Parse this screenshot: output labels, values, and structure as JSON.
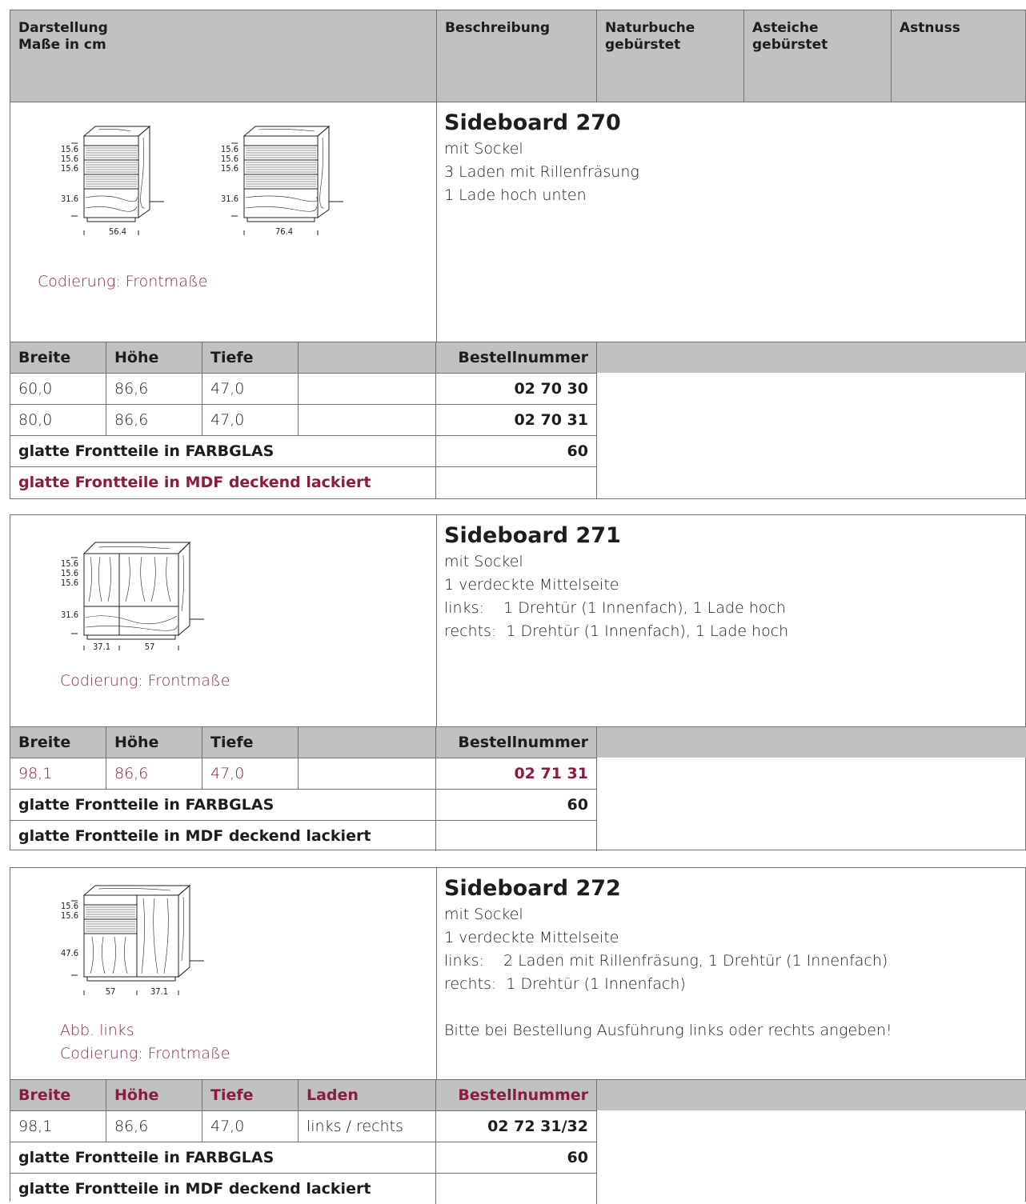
{
  "header": {
    "col1": [
      "Darstellung",
      "Maße in cm"
    ],
    "col2": "Beschreibung",
    "col3": [
      "Naturbuche",
      "gebürstet"
    ],
    "col4": [
      "Asteiche",
      "gebürstet"
    ],
    "col5": "Astnuss"
  },
  "table_headers": {
    "breite": "Breite",
    "hoehe": "Höhe",
    "tiefe": "Tiefe",
    "laden": "Laden",
    "bestell": "Bestellnummer"
  },
  "sections": [
    {
      "title": "Sideboard 270",
      "desc": [
        "mit Sockel",
        "3 Laden mit Rillenfräsung",
        "1 Lade hoch unten"
      ],
      "coding": "Codierung: Frontmaße",
      "dims_a": {
        "h": [
          "15.6",
          "15.6",
          "15.6",
          "31.6"
        ],
        "w": "56.4"
      },
      "dims_b": {
        "h": [
          "15.6",
          "15.6",
          "15.6",
          "31.6"
        ],
        "w": "76.4"
      },
      "rows": [
        {
          "breite": "60,0",
          "hoehe": "86,6",
          "tiefe": "47,0",
          "nr": "02 70 30"
        },
        {
          "breite": "80,0",
          "hoehe": "86,6",
          "tiefe": "47,0",
          "nr": "02 70 31"
        }
      ],
      "farbglas": {
        "label": "glatte Frontteile in FARBGLAS",
        "value": "60"
      },
      "mdf": {
        "label": "glatte Frontteile in MDF deckend lackiert",
        "value": ""
      }
    },
    {
      "title": "Sideboard 271",
      "desc": [
        "mit Sockel",
        "1 verdeckte Mittelseite",
        "links:    1 Drehtür (1 Innenfach), 1 Lade hoch",
        "rechts:  1 Drehtür (1 Innenfach), 1 Lade hoch"
      ],
      "coding": "Codierung: Frontmaße",
      "dims": {
        "h": [
          "15.6",
          "15.6",
          "15.6",
          "31.6"
        ],
        "w1": "37.1",
        "w2": "57"
      },
      "rows": [
        {
          "breite": "98,1",
          "hoehe": "86,6",
          "tiefe": "47,0",
          "nr": "02 71 31"
        }
      ],
      "farbglas": {
        "label": "glatte Frontteile in FARBGLAS",
        "value": "60"
      },
      "mdf": {
        "label": "glatte Frontteile in MDF deckend lackiert",
        "value": ""
      }
    },
    {
      "title": "Sideboard 272",
      "desc": [
        "mit Sockel",
        "1 verdeckte Mittelseite",
        "links:    2 Laden mit Rillenfräsung, 1 Drehtür (1 Innenfach)",
        "rechts:  1 Drehtür (1 Innenfach)",
        "",
        "Bitte bei Bestellung Ausführung links oder rechts angeben!"
      ],
      "abb": "Abb. links",
      "coding": "Codierung: Frontmaße",
      "dims": {
        "h": [
          "15.6",
          "15.6",
          "47.6"
        ],
        "w1": "57",
        "w2": "37.1"
      },
      "rows": [
        {
          "breite": "98,1",
          "hoehe": "86,6",
          "tiefe": "47,0",
          "laden": "links / rechts",
          "nr": "02 72 31/32"
        }
      ],
      "farbglas": {
        "label": "glatte Frontteile in FARBGLAS",
        "value": "60"
      },
      "mdf": {
        "label": "glatte Frontteile in MDF deckend lackiert",
        "value": ""
      }
    }
  ]
}
